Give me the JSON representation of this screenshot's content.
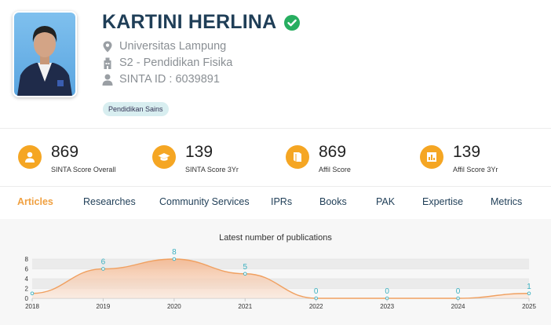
{
  "profile": {
    "name": "KARTINI HERLINA",
    "university": "Universitas Lampung",
    "program": "S2 - Pendidikan Fisika",
    "sinta_id": "SINTA ID : 6039891",
    "tag": "Pendidikan Sains"
  },
  "stats": [
    {
      "value": "869",
      "label": "SINTA Score Overall",
      "icon": "user-icon"
    },
    {
      "value": "139",
      "label": "SINTA Score 3Yr",
      "icon": "graduation-cap-icon"
    },
    {
      "value": "869",
      "label": "Affil Score",
      "icon": "book-icon"
    },
    {
      "value": "139",
      "label": "Affil Score 3Yr",
      "icon": "bar-chart-icon"
    }
  ],
  "tabs": [
    {
      "label": "Articles",
      "active": true
    },
    {
      "label": "Researches"
    },
    {
      "label": "Community Services"
    },
    {
      "label": "IPRs"
    },
    {
      "label": "Books"
    },
    {
      "label": "PAK"
    },
    {
      "label": "Expertise"
    },
    {
      "label": "Metrics"
    }
  ],
  "colors": {
    "accent": "#f5a623",
    "title": "#1f3e57",
    "verified": "#27ae60",
    "line": "#f0a060",
    "label": "#3ab0c0"
  },
  "chart_data": {
    "type": "area",
    "title": "Latest number of publications",
    "x": [
      "2018",
      "2019",
      "2020",
      "2021",
      "2022",
      "2023",
      "2024",
      "2025"
    ],
    "values": [
      1,
      6,
      8,
      5,
      0,
      0,
      0,
      1
    ],
    "data_labels": [
      "",
      "6",
      "8",
      "5",
      "0",
      "0",
      "0",
      "1"
    ],
    "ylim": [
      0,
      8
    ],
    "yticks": [
      "0",
      "2",
      "4",
      "6",
      "8"
    ],
    "grid": true
  }
}
